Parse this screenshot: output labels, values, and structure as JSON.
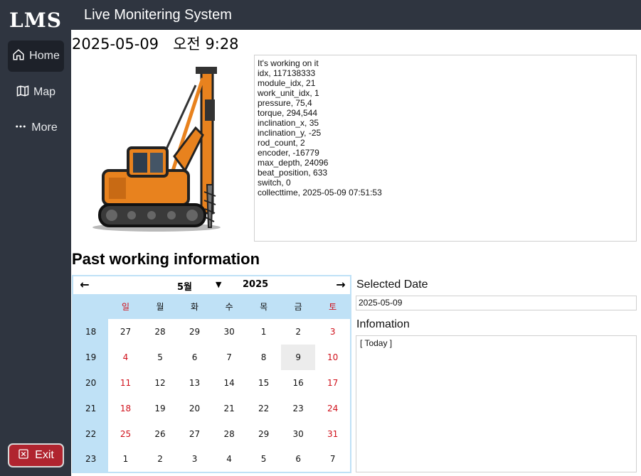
{
  "sidebar": {
    "logo": "LMS",
    "items": [
      {
        "label": "Home",
        "icon": "home-icon",
        "active": true
      },
      {
        "label": "Map",
        "icon": "map-icon",
        "active": false
      },
      {
        "label": "More",
        "icon": "more-icon",
        "active": false
      }
    ],
    "exit_label": "Exit",
    "exit_icon": "close-square-icon"
  },
  "header": {
    "title": "Live Monitering System"
  },
  "main": {
    "datetime": "2025-05-09   오전 9:28",
    "status_lines": [
      "It's working on it",
      "",
      "idx, 117138333",
      "module_idx, 21",
      "work_unit_idx, 1",
      "pressure, 75,4",
      "torque, 294,544",
      "inclination_x, 35",
      "inclination_y, -25",
      "rod_count, 2",
      "encoder, -16779",
      "max_depth, 24096",
      "beat_position, 633",
      "switch, 0",
      "collecttime, 2025-05-09 07:51:53"
    ],
    "section_title": "Past working information"
  },
  "calendar": {
    "prev_icon": "arrow-left-icon",
    "next_icon": "arrow-right-icon",
    "month": "5월",
    "year": "2025",
    "weekdays": [
      "일",
      "월",
      "화",
      "수",
      "목",
      "금",
      "토"
    ],
    "weeks": [
      {
        "week": "18",
        "days": [
          "27",
          "28",
          "29",
          "30",
          "1",
          "2",
          "3"
        ]
      },
      {
        "week": "19",
        "days": [
          "4",
          "5",
          "6",
          "7",
          "8",
          "9",
          "10"
        ]
      },
      {
        "week": "20",
        "days": [
          "11",
          "12",
          "13",
          "14",
          "15",
          "16",
          "17"
        ]
      },
      {
        "week": "21",
        "days": [
          "18",
          "19",
          "20",
          "21",
          "22",
          "23",
          "24"
        ]
      },
      {
        "week": "22",
        "days": [
          "25",
          "26",
          "27",
          "28",
          "29",
          "30",
          "31"
        ]
      },
      {
        "week": "23",
        "days": [
          "1",
          "2",
          "3",
          "4",
          "5",
          "6",
          "7"
        ]
      }
    ],
    "selected_day": "9",
    "weekend_color": "#d0101a",
    "header_color": "#bfe1f6"
  },
  "right_panel": {
    "selected_date_label": "Selected Date",
    "selected_date_value": "2025-05-09",
    "info_label": "Infomation",
    "info_text": "[ Today ]"
  },
  "colors": {
    "sidebar_bg": "#2f3540",
    "active_nav_bg": "#1d2129",
    "exit_bg": "#b0242f",
    "machine_orange": "#e8821e"
  }
}
